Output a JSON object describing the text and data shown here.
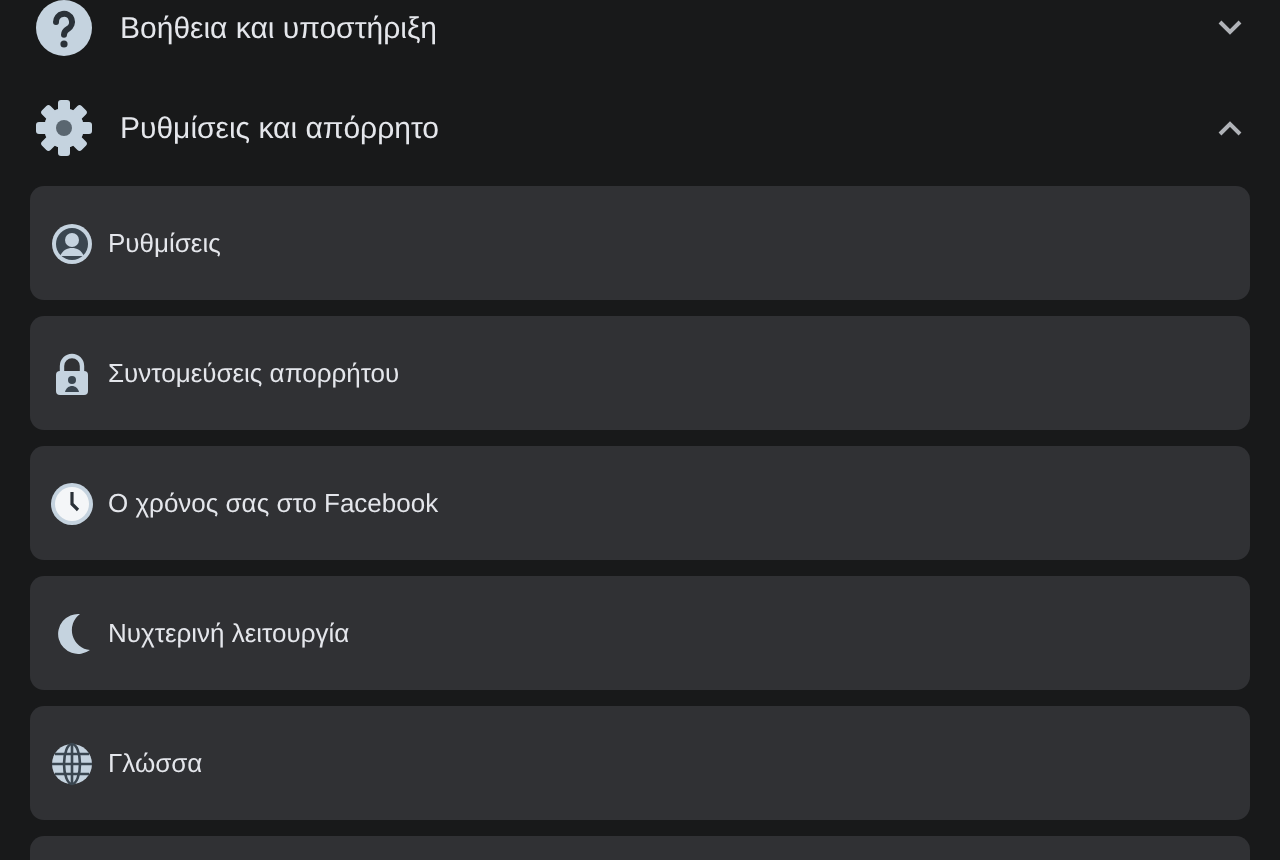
{
  "sections": [
    {
      "kind": "help",
      "title": "Βοήθεια και υποστήριξη",
      "expanded": false
    },
    {
      "kind": "gear",
      "title": "Ρυθμίσεις και απόρρητο",
      "expanded": true,
      "items": [
        {
          "kind": "profile",
          "label": "Ρυθμίσεις"
        },
        {
          "kind": "lock",
          "label": "Συντομεύσεις απορρήτου"
        },
        {
          "kind": "clock",
          "label": "Ο χρόνος σας στο Facebook"
        },
        {
          "kind": "moon",
          "label": "Νυχτερινή λειτουργία"
        },
        {
          "kind": "globe",
          "label": "Γλώσσα"
        }
      ],
      "more_below": true
    }
  ]
}
